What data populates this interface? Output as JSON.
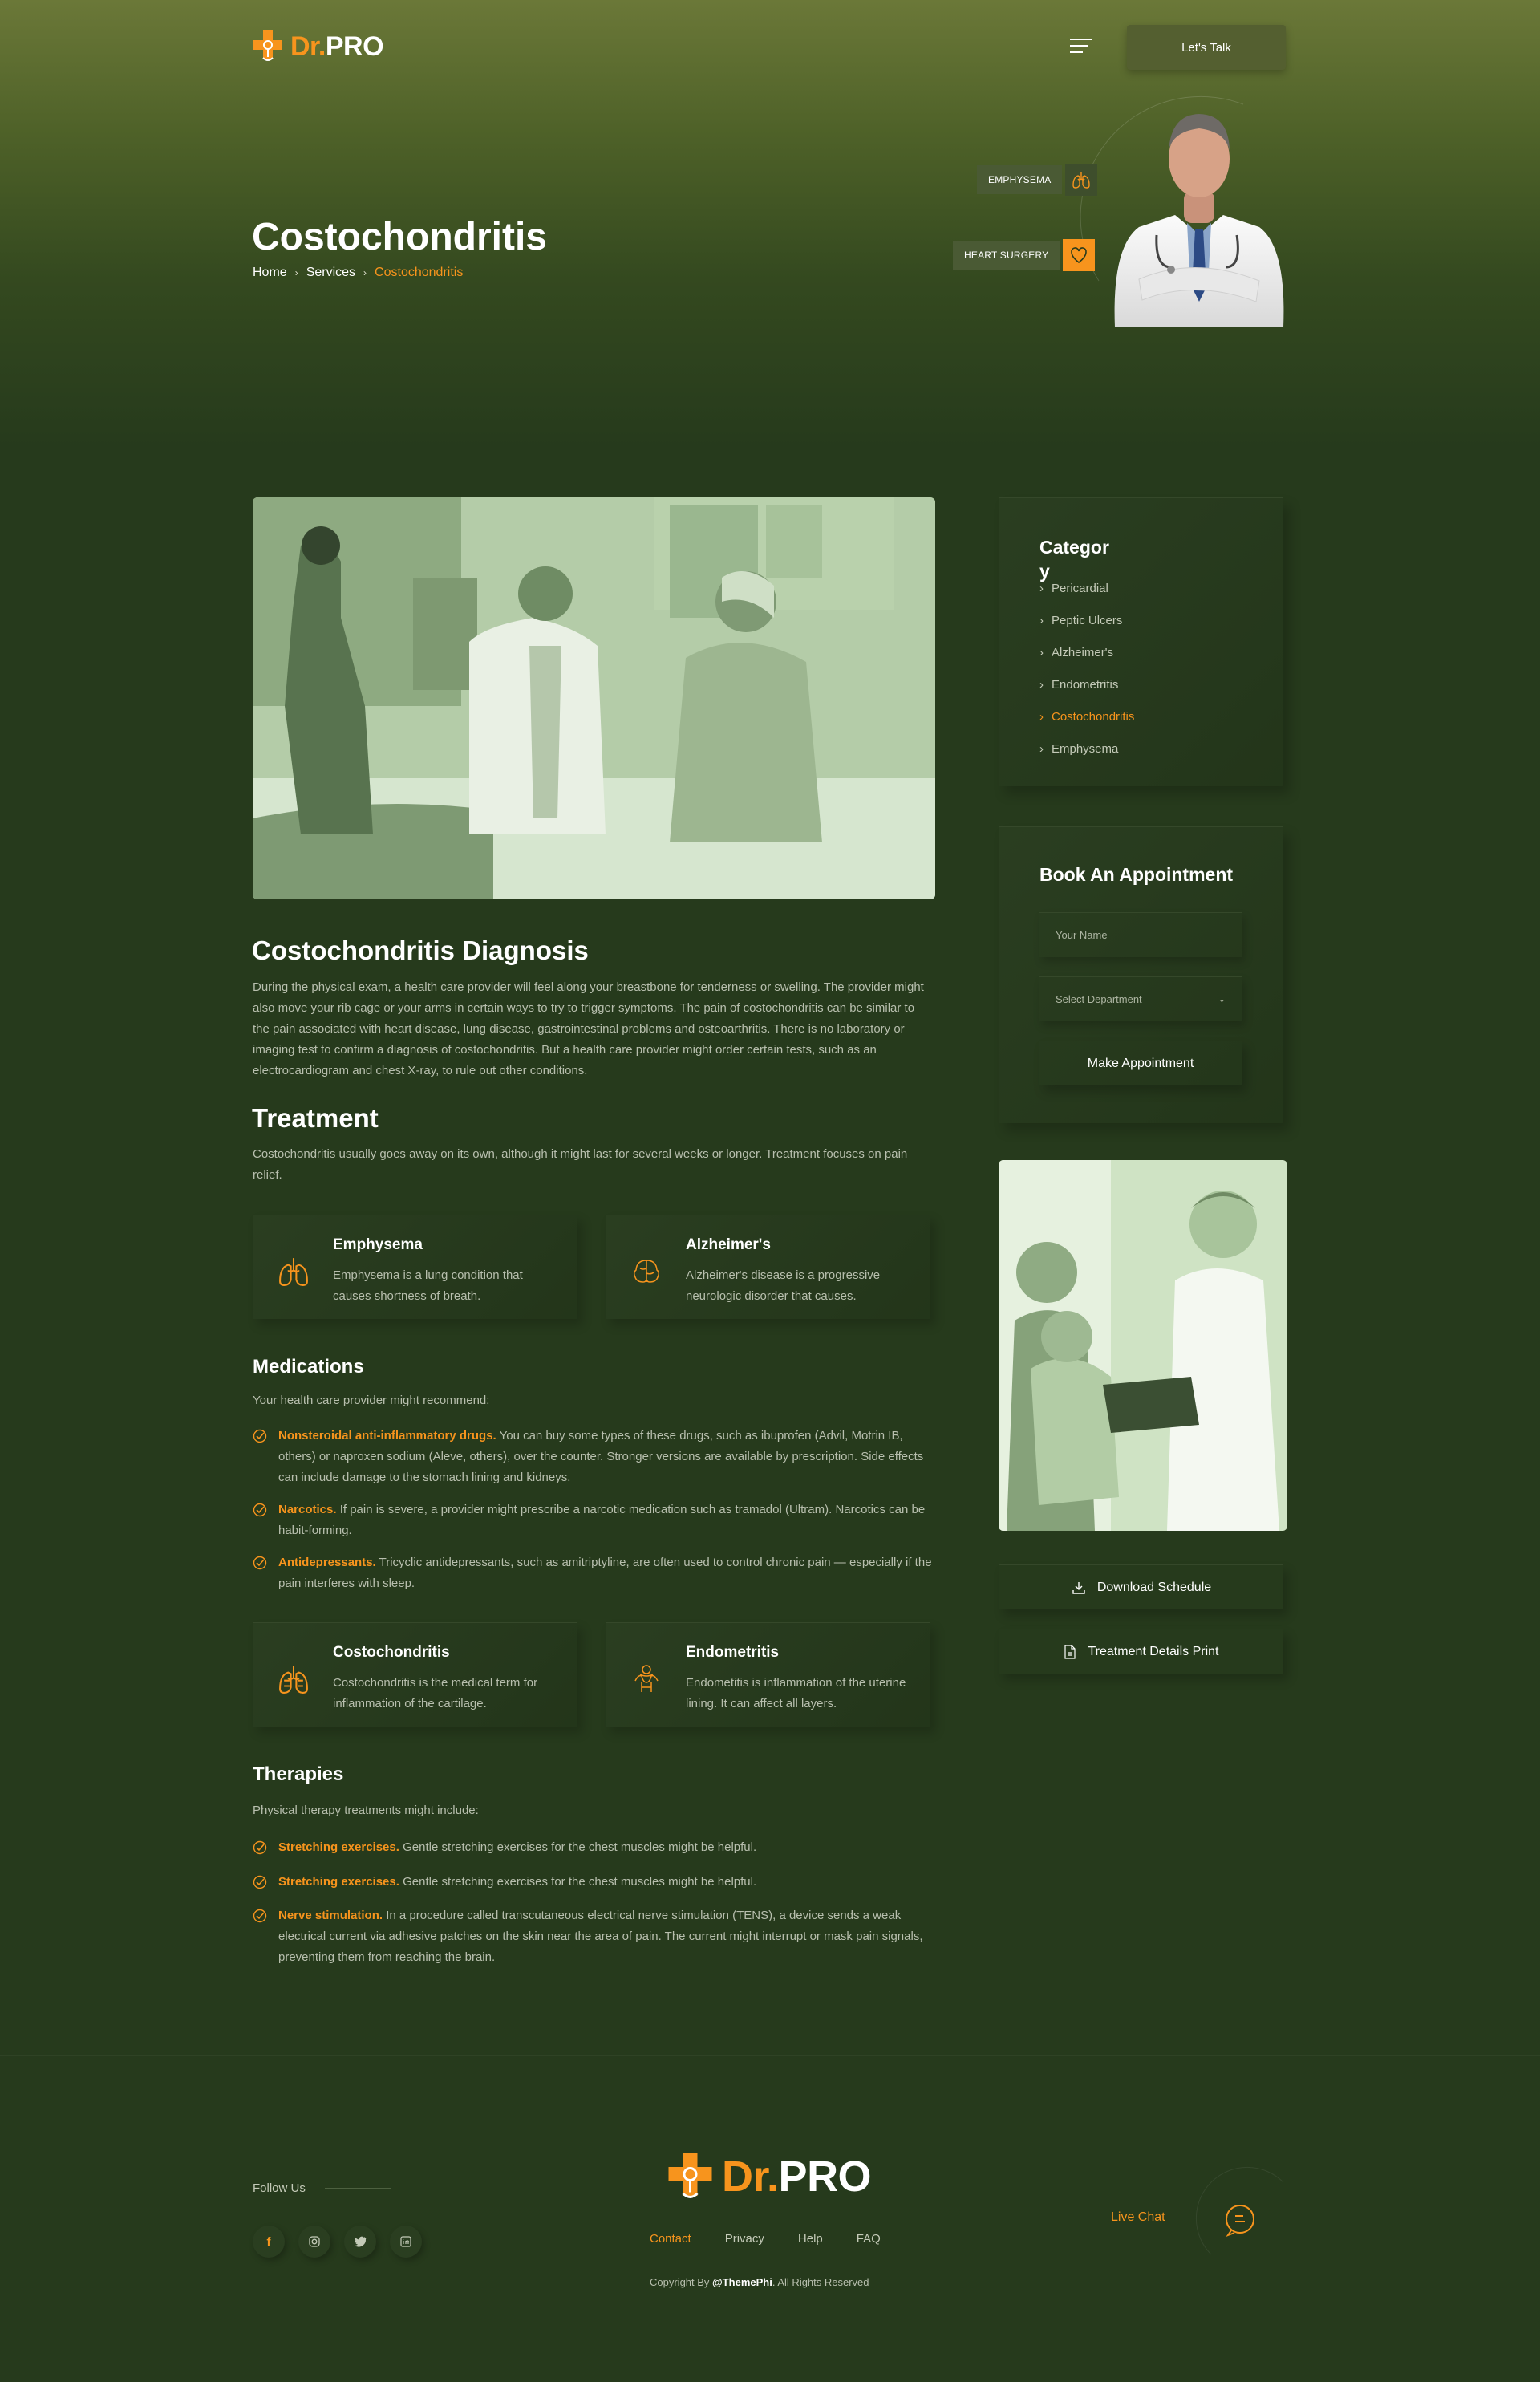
{
  "header": {
    "logo_dr": "Dr.",
    "logo_pro": "PRO",
    "cta_label": "Let's Talk"
  },
  "hero": {
    "title": "Costochondritis",
    "breadcrumb": [
      "Home",
      "Services",
      "Costochondritis"
    ],
    "tags": [
      "EMPHYSEMA",
      "HEART SURGERY"
    ]
  },
  "main": {
    "diagnosis_title": "Costochondritis Diagnosis",
    "diagnosis_text": "During the physical exam, a health care provider will feel along your breastbone for tenderness or swelling. The provider might also move your rib cage or your arms in certain ways to try to trigger symptoms. The pain of costochondritis can be similar to the pain associated with heart disease, lung disease, gastrointestinal problems and osteoarthritis. There is no laboratory or imaging test to confirm a diagnosis of costochondritis. But a health care provider might order certain tests, such as an electrocardiogram and chest X-ray, to rule out other conditions.",
    "treatment_title": "Treatment",
    "treatment_text": "Costochondritis usually goes away on its own, although it might last for several weeks or longer. Treatment focuses on pain relief.",
    "cards_top": [
      {
        "title": "Emphysema",
        "desc": "Emphysema is a lung condition that causes shortness of breath.",
        "icon": "lungs-icon"
      },
      {
        "title": "Alzheimer's",
        "desc": "Alzheimer's disease is a progressive neurologic disorder that causes.",
        "icon": "brain-icon"
      }
    ],
    "medications_title": "Medications",
    "medications_intro": "Your health care provider might recommend:",
    "medications": [
      {
        "label": "Nonsteroidal anti-inflammatory drugs.",
        "text": " You can buy some types of these drugs, such as ibuprofen (Advil, Motrin IB, others) or naproxen sodium (Aleve, others), over the counter. Stronger versions are available by prescription. Side effects can include damage to the stomach lining and kidneys."
      },
      {
        "label": "Narcotics.",
        "text": " If pain is severe, a provider might prescribe a narcotic medication such as tramadol (Ultram). Narcotics can be habit-forming."
      },
      {
        "label": "Antidepressants.",
        "text": " Tricyclic antidepressants, such as amitriptyline, are often used to control chronic pain — especially if the pain interferes with sleep."
      }
    ],
    "cards_bottom": [
      {
        "title": "Costochondritis",
        "desc": "Costochondritis is the medical term for inflammation of the cartilage.",
        "icon": "lungs-icon"
      },
      {
        "title": "Endometritis",
        "desc": "Endometitis is inflammation of the uterine lining. It can affect all layers.",
        "icon": "uterus-icon"
      }
    ],
    "therapies_title": "Therapies",
    "therapies_intro": "Physical therapy treatments might include:",
    "therapies": [
      {
        "label": "Stretching exercises.",
        "text": " Gentle stretching exercises for the chest muscles might be helpful."
      },
      {
        "label": "Stretching exercises.",
        "text": " Gentle stretching exercises for the chest muscles might be helpful."
      },
      {
        "label": "Nerve stimulation.",
        "text": " In a procedure called transcutaneous electrical nerve stimulation (TENS), a device sends a weak electrical current via adhesive patches on the skin near the area of pain. The current might interrupt or mask pain signals, preventing them from reaching the brain."
      }
    ]
  },
  "sidebar": {
    "category_title_1": "Categor",
    "category_title_2": "y",
    "categories": [
      "Pericardial",
      "Peptic Ulcers",
      "Alzheimer's",
      "Endometritis",
      "Costochondritis",
      "Emphysema"
    ],
    "active_category": "Costochondritis",
    "appointment_title": "Book An Appointment",
    "name_placeholder": "Your Name",
    "department_placeholder": "Select Department",
    "submit_label": "Make Appointment",
    "download_label": "Download Schedule",
    "print_label": "Treatment Details Print"
  },
  "footer": {
    "follow_label": "Follow Us",
    "nav": [
      "Contact",
      "Privacy",
      "Help",
      "FAQ"
    ],
    "copyright_pre": "Copyright By ",
    "copyright_brand": "@ThemePhi",
    "copyright_post": ". All Rights Reserved",
    "live_chat": "Live Chat"
  },
  "colors": {
    "accent": "#f7941d",
    "background": "#263a1c",
    "hero_top": "#6b7838"
  }
}
